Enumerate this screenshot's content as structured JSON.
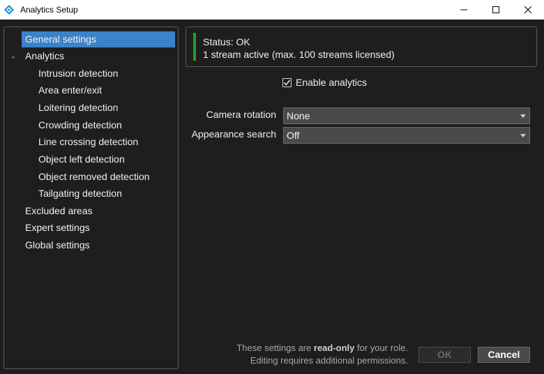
{
  "window": {
    "title": "Analytics Setup",
    "controls": [
      "minimize",
      "maximize",
      "close"
    ]
  },
  "tree": {
    "items": [
      {
        "label": "General settings",
        "level": 0,
        "selected": true
      },
      {
        "label": "Analytics",
        "level": 0,
        "expanded": true
      },
      {
        "label": "Intrusion detection",
        "level": 1
      },
      {
        "label": "Area enter/exit",
        "level": 1
      },
      {
        "label": "Loitering detection",
        "level": 1
      },
      {
        "label": "Crowding detection",
        "level": 1
      },
      {
        "label": "Line crossing detection",
        "level": 1
      },
      {
        "label": "Object left detection",
        "level": 1
      },
      {
        "label": "Object removed detection",
        "level": 1
      },
      {
        "label": "Tailgating detection",
        "level": 1
      },
      {
        "label": "Excluded areas",
        "level": 0
      },
      {
        "label": "Expert settings",
        "level": 0
      },
      {
        "label": "Global settings",
        "level": 0
      }
    ]
  },
  "status": {
    "line1": "Status: OK",
    "line2": "1 stream active (max. 100 streams licensed)",
    "color": "#1fa21f"
  },
  "enable_analytics": {
    "label": "Enable analytics",
    "checked": true
  },
  "form": {
    "camera_rotation": {
      "label": "Camera rotation",
      "value": "None"
    },
    "appearance_search": {
      "label": "Appearance search",
      "value": "Off"
    }
  },
  "footer": {
    "note_prefix": "These settings are ",
    "note_bold": "read-only",
    "note_suffix": " for your role.",
    "note_line2": "Editing requires additional permissions.",
    "ok_label": "OK",
    "cancel_label": "Cancel"
  },
  "colors": {
    "selection": "#3b82c9",
    "background": "#1e1e1e"
  }
}
